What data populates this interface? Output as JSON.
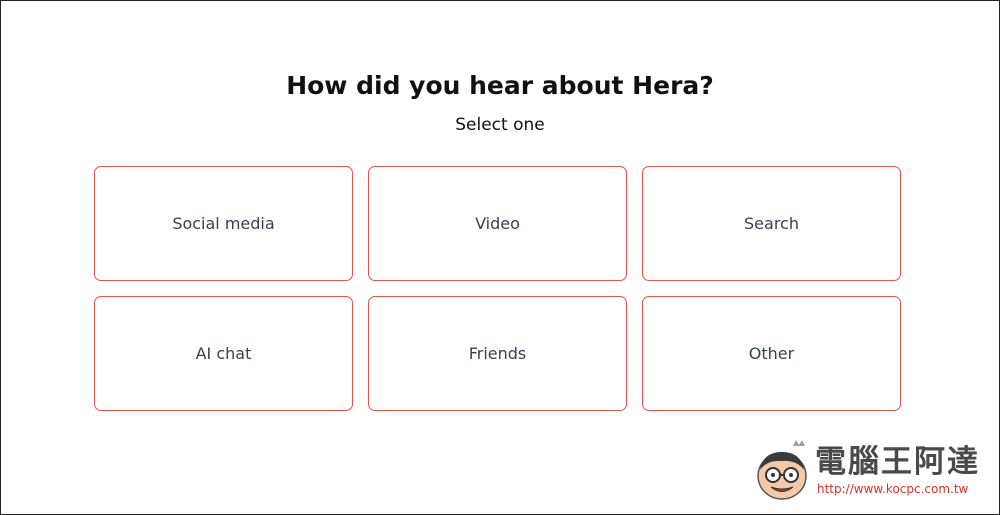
{
  "survey": {
    "question": "How did you hear about Hera?",
    "subtitle": "Select one",
    "options": [
      {
        "label": "Social media"
      },
      {
        "label": "Video"
      },
      {
        "label": "Search"
      },
      {
        "label": "AI chat"
      },
      {
        "label": "Friends"
      },
      {
        "label": "Other"
      }
    ]
  },
  "watermark": {
    "title": "電腦王阿達",
    "url": "http://www.kocpc.com.tw"
  },
  "colors": {
    "card_border": "#d9584f",
    "title_text": "#111111",
    "option_text": "#374151",
    "watermark_url": "#d9342b"
  }
}
